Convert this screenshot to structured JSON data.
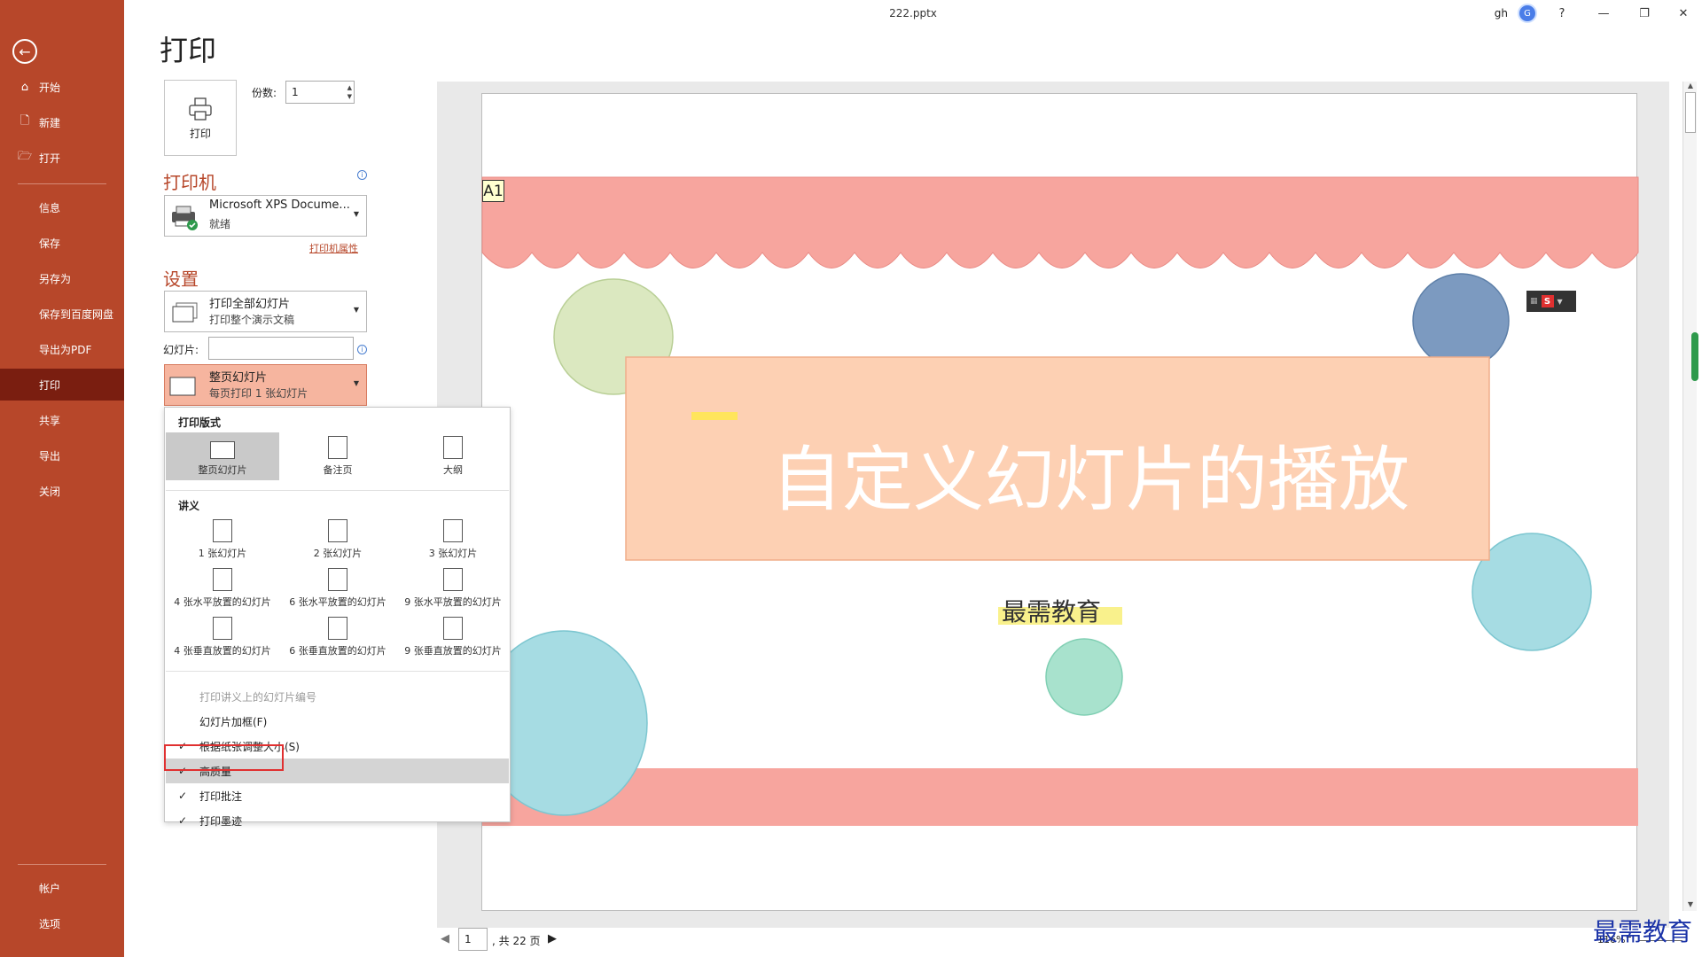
{
  "window": {
    "filename": "222.pptx",
    "user": "gh",
    "avatar_initial": "G",
    "help": "?",
    "minimize": "—",
    "restore": "❐",
    "close": "✕"
  },
  "sidebar": {
    "back_icon": "back-arrow-icon",
    "items": [
      {
        "label": "开始",
        "icon": "⌂"
      },
      {
        "label": "新建",
        "icon": "🗋"
      },
      {
        "label": "打开",
        "icon": "🗁"
      },
      {
        "label": "信息"
      },
      {
        "label": "保存"
      },
      {
        "label": "另存为"
      },
      {
        "label": "保存到百度网盘"
      },
      {
        "label": "导出为PDF"
      },
      {
        "label": "打印"
      },
      {
        "label": "共享"
      },
      {
        "label": "导出"
      },
      {
        "label": "关闭"
      },
      {
        "label": "帐户"
      },
      {
        "label": "选项"
      }
    ],
    "accent": "#b7472a",
    "active_bg": "#7a1e10"
  },
  "print": {
    "title": "打印",
    "button_label": "打印",
    "copies_label": "份数:",
    "copies_value": "1",
    "printer_heading": "打印机",
    "printer_name": "Microsoft XPS Docume...",
    "printer_status": "就绪",
    "printer_props_link": "打印机属性",
    "settings_heading": "设置",
    "range_line1": "打印全部幻灯片",
    "range_line2": "打印整个演示文稿",
    "slides_label": "幻灯片:",
    "slides_value": "",
    "layout_line1": "整页幻灯片",
    "layout_line2": "每页打印 1 张幻灯片"
  },
  "layout_menu": {
    "section_layout": "打印版式",
    "layout_options": [
      "整页幻灯片",
      "备注页",
      "大纲"
    ],
    "section_handouts": "讲义",
    "handout_options": [
      "1 张幻灯片",
      "2 张幻灯片",
      "3 张幻灯片",
      "4 张水平放置的幻灯片",
      "6 张水平放置的幻灯片",
      "9 张水平放置的幻灯片",
      "4 张垂直放置的幻灯片",
      "6 张垂直放置的幻灯片",
      "9 张垂直放置的幻灯片"
    ],
    "toggles": [
      {
        "label": "打印讲义上的幻灯片编号",
        "checked": false,
        "disabled": true
      },
      {
        "label": "幻灯片加框(F)",
        "checked": false
      },
      {
        "label": "根据纸张调整大小(S)",
        "checked": true
      },
      {
        "label": "高质量",
        "checked": true,
        "highlighted": true
      },
      {
        "label": "打印批注",
        "checked": true
      },
      {
        "label": "打印墨迹",
        "checked": true
      }
    ],
    "check_mark": "✓"
  },
  "preview": {
    "slide_title": "自定义幻灯片的播放",
    "slide_subtitle": "最需教育",
    "cell_tag": "A1",
    "wps_letter": "S"
  },
  "footer": {
    "page_value": "1",
    "page_total": ", 共 22 页",
    "prev": "◀",
    "next": "▶",
    "zoom": "116%",
    "zoom_minus": "–"
  },
  "watermark": "最需教育"
}
